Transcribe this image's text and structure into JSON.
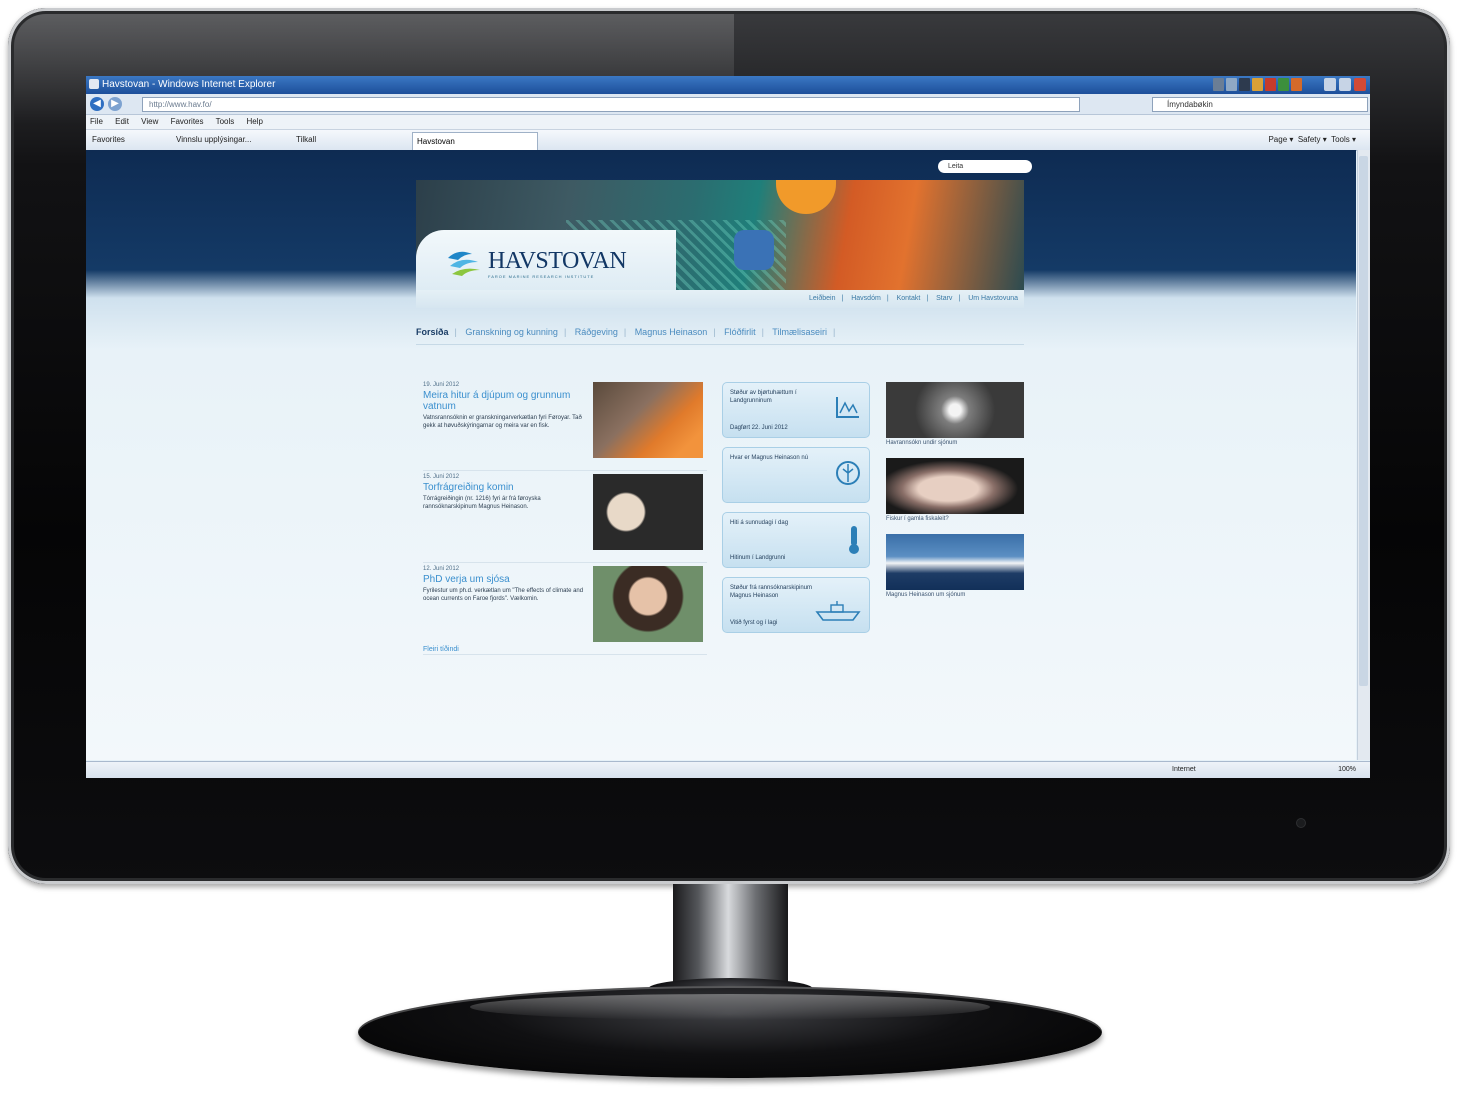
{
  "browser": {
    "title": "Havstovan - Windows Internet Explorer",
    "address": "http://www.hav.fo/",
    "search_placeholder": "Ímyndabøkin",
    "menu": [
      "File",
      "Edit",
      "View",
      "Favorites",
      "Tools",
      "Help"
    ],
    "favorites_label": "Favorites",
    "fav_items": [
      "Vinnslu upplýsingar...",
      "Tilkall"
    ],
    "tab_label": "Havstovan",
    "commands": [
      "Page ▾",
      "Safety ▾",
      "Tools ▾"
    ],
    "status_zone": "Internet",
    "zoom": "100%"
  },
  "site": {
    "search_label": "Leita",
    "logo_text": "HAVSTOVAN",
    "logo_sub": "FAROE MARINE RESEARCH INSTITUTE",
    "sub_links": [
      "Leiðbein",
      "Havsdóm",
      "Kontakt",
      "Starv",
      "Um Havstovuna"
    ],
    "main_nav": [
      "Forsíða",
      "Granskning og kunning",
      "Ráðgeving",
      "Magnus Heinason",
      "Flóðfirlit",
      "Tilmælisaseiri"
    ],
    "news": [
      {
        "date": "19. Juni 2012",
        "headline": "Meira hitur á djúpum og grunnum vatnum",
        "body": "Vatnsrannsóknin er granskningarverkætlan fyri Føroyar. Tað gekk at høvuðskýringarnar og meira var en fisk."
      },
      {
        "date": "15. Juni 2012",
        "headline": "Torfrágreiðing komin",
        "body": "Tórrágreiðingin (nr. 1216) fyri ár frá føroyska rannsóknarskipinum Magnus Heinason."
      },
      {
        "date": "12. Juni 2012",
        "headline": "PhD verja um sjósa",
        "body": "Fyrilestur um ph.d. verkætlan um \"The effects of climate and ocean currents on Faroe fjords\". Vælkomin."
      }
    ],
    "more_news": "Fleiri tíðindi",
    "tools": [
      {
        "label": "Støður av bjørtuhættum í Landgrunninum",
        "sub": "Dagført 22. Juni 2012",
        "icon": "chart-icon"
      },
      {
        "label": "Hvar er Magnus Heinason nú",
        "sub": "",
        "icon": "compass-icon"
      },
      {
        "label": "Hiti á sunnudagi í dag",
        "sub": "Hitinum í Landgrunni",
        "icon": "thermometer-icon"
      },
      {
        "label": "Støður frá rannsóknarskipinum Magnus Heinason",
        "sub": "Vitið fyrst og í lagi",
        "icon": "ship-icon"
      }
    ],
    "gallery": [
      {
        "caption": "Havrannsókn undir sjónum"
      },
      {
        "caption": "Fiskur í gamla fiskaleit?"
      },
      {
        "caption": "Magnus Heinason um sjónum"
      }
    ]
  }
}
